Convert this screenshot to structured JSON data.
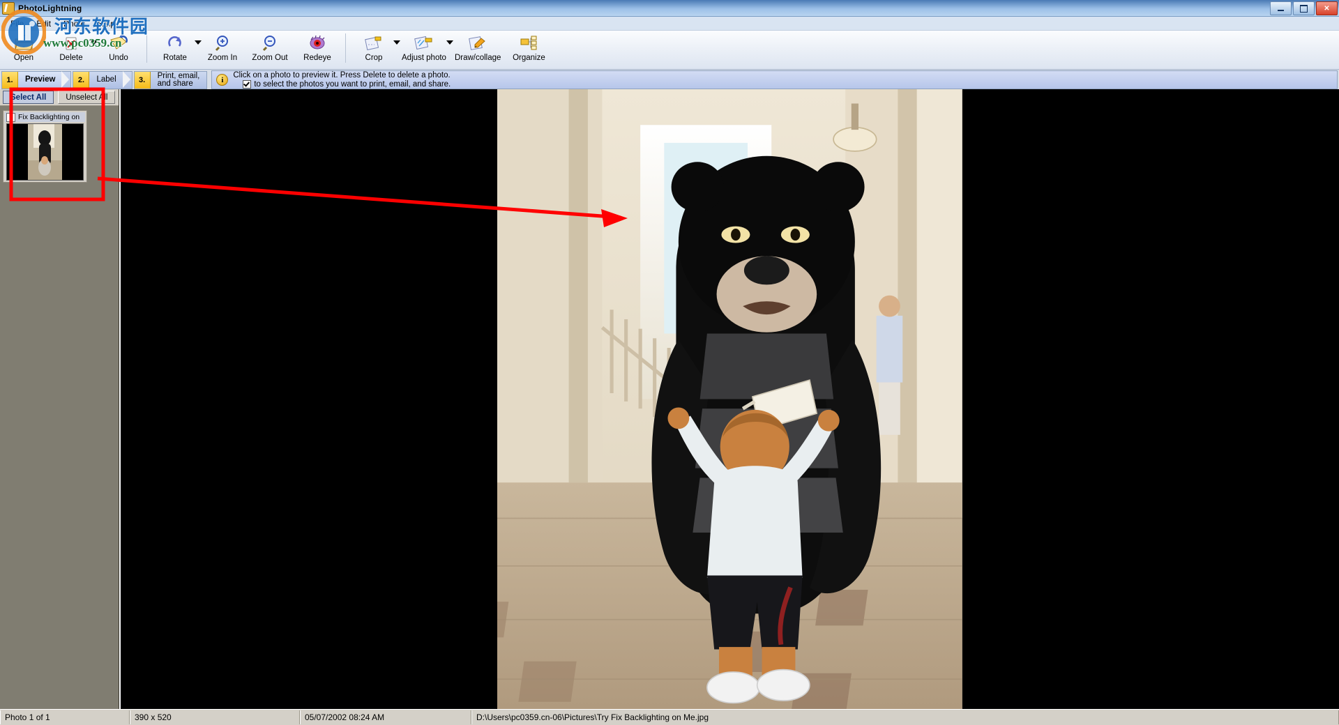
{
  "window": {
    "title": "PhotoLightning",
    "icon": "app-lightning-icon",
    "controls": {
      "minimize": "–",
      "maximize": "□",
      "close": "✕"
    }
  },
  "menu": {
    "items": [
      {
        "label": "File"
      },
      {
        "label": "Edit"
      },
      {
        "label": "Photo"
      },
      {
        "label": "Help"
      }
    ]
  },
  "toolbar": {
    "buttons": [
      {
        "label": "Open",
        "icon": "open-folder-icon",
        "dropdown": false
      },
      {
        "label": "Delete",
        "icon": "delete-icon",
        "dropdown": true
      },
      {
        "label": "Undo",
        "icon": "undo-icon",
        "dropdown": false
      },
      {
        "label": "Rotate",
        "icon": "rotate-icon",
        "dropdown": true
      },
      {
        "label": "Zoom In",
        "icon": "zoom-in-icon",
        "dropdown": false
      },
      {
        "label": "Zoom Out",
        "icon": "zoom-out-icon",
        "dropdown": false
      },
      {
        "label": "Redeye",
        "icon": "redeye-icon",
        "dropdown": false
      },
      {
        "label": "Crop",
        "icon": "crop-icon",
        "dropdown": true
      },
      {
        "label": "Adjust photo",
        "icon": "adjust-photo-icon",
        "dropdown": true
      },
      {
        "label": "Draw/collage",
        "icon": "draw-collage-icon",
        "dropdown": false
      },
      {
        "label": "Organize",
        "icon": "organize-icon",
        "dropdown": false
      }
    ]
  },
  "steps": [
    {
      "num": "1.",
      "label": "Preview",
      "active": true
    },
    {
      "num": "2.",
      "label": "Label",
      "active": false
    },
    {
      "num": "3.",
      "label": "Print, email,\nand share",
      "active": false
    }
  ],
  "info": {
    "icon": "info-icon",
    "line1": "Click on a photo to preview it.  Press Delete to delete a photo.",
    "line2": "to select the photos you want to print, email, and share.",
    "checkbox_checked": true
  },
  "sidebar": {
    "select_all": "Select All",
    "unselect_all": "Unselect All",
    "thumbnail": {
      "caption": "Fix Backlighting on",
      "checkbox_checked": false
    }
  },
  "statusbar": {
    "cells": [
      {
        "name": "photo-count",
        "text": "Photo 1 of 1"
      },
      {
        "name": "dimensions",
        "text": "390 x 520"
      },
      {
        "name": "datetime",
        "text": "05/07/2002  08:24 AM"
      },
      {
        "name": "filepath",
        "text": "D:\\Users\\pc0359.cn-06\\Pictures\\Try Fix Backlighting on Me.jpg"
      }
    ]
  },
  "watermark": {
    "chinese": "河东软件园",
    "url": "www.pc0359.cn"
  },
  "annotation": {
    "type": "arrow",
    "color": "#ff0000",
    "description": "red box around thumbnail with arrow pointing to preview"
  },
  "colors": {
    "accent": "#f5bb18",
    "steps_blue": "#aebfe4",
    "sidebar": "#807d71",
    "preview_bg": "#000000",
    "annotation": "#ff0000"
  }
}
